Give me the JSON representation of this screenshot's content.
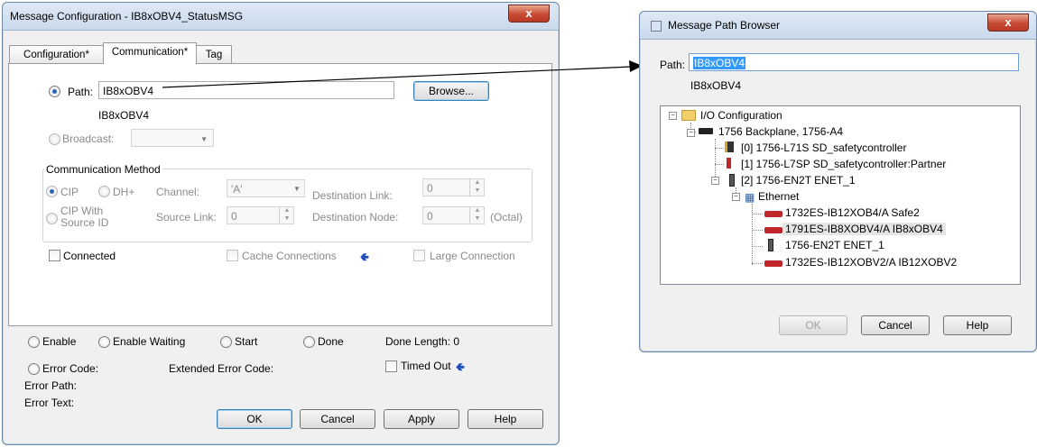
{
  "msg_dialog": {
    "title": "Message Configuration - IB8xOBV4_StatusMSG",
    "close_label": "x",
    "tabs": [
      "Configuration*",
      "Communication*",
      "Tag"
    ],
    "path_label": "Path:",
    "path_value": "IB8xOBV4",
    "browse_label": "Browse...",
    "path_resolved": "IB8xOBV4",
    "broadcast_label": "Broadcast:",
    "comm_method_label": "Communication Method",
    "cip_label": "CIP",
    "dhplus_label": "DH+",
    "channel_label": "Channel:",
    "channel_value": "'A'",
    "dest_link_label": "Destination Link:",
    "dest_link_value": "0",
    "cip_source_label_1": "CIP With",
    "cip_source_label_2": "Source ID",
    "source_link_label": "Source Link:",
    "source_link_value": "0",
    "dest_node_label": "Destination Node:",
    "dest_node_value": "0",
    "octal_label": "(Octal)",
    "connected_label": "Connected",
    "cache_label": "Cache Connections",
    "large_label": "Large Connection",
    "status": {
      "enable": "Enable",
      "enable_waiting": "Enable Waiting",
      "start": "Start",
      "done": "Done",
      "done_length": "Done Length: 0",
      "error_code": "Error Code:",
      "extended_error": "Extended Error Code:",
      "timed_out": "Timed Out",
      "error_path": "Error Path:",
      "error_text": "Error Text:"
    },
    "buttons": {
      "ok": "OK",
      "cancel": "Cancel",
      "apply": "Apply",
      "help": "Help"
    }
  },
  "path_browser": {
    "title": "Message Path Browser",
    "close_label": "x",
    "path_label": "Path:",
    "path_value": "IB8xOBV4",
    "path_resolved": "IB8xOBV4",
    "tree": [
      "I/O Configuration",
      "1756 Backplane, 1756-A4",
      "[0] 1756-L71S SD_safetycontroller",
      "[1] 1756-L7SP SD_safetycontroller:Partner",
      "[2] 1756-EN2T ENET_1",
      "Ethernet",
      "1732ES-IB12XOB4/A Safe2",
      "1791ES-IB8XOBV4/A IB8xOBV4",
      "1756-EN2T ENET_1",
      "1732ES-IB12XOBV2/A IB12XOBV2"
    ],
    "buttons": {
      "ok": "OK",
      "cancel": "Cancel",
      "help": "Help"
    }
  },
  "colors": {
    "accent": "#2a64b5",
    "selection": "#3399ff",
    "module_red": "#c0262a",
    "arrow_blue": "#1f4fbf"
  },
  "icons": [
    "folder-icon",
    "backplane-icon",
    "controller-icon",
    "network-icon",
    "module-icon",
    "close-icon",
    "arrow-left-icon"
  ]
}
